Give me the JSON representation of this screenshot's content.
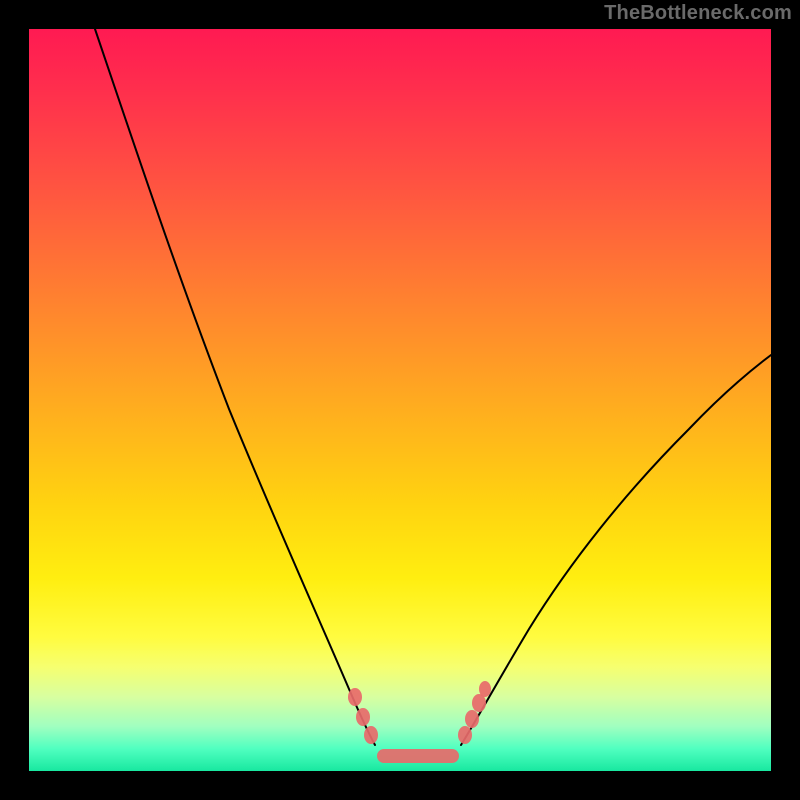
{
  "watermark": "TheBottleneck.com",
  "colors": {
    "frame": "#000000",
    "curve": "#000000",
    "marker": "#e86a6a",
    "gradient_top": "#ff1a52",
    "gradient_bottom": "#18e8a0"
  },
  "chart_data": {
    "type": "line",
    "title": "",
    "xlabel": "",
    "ylabel": "",
    "xlim": [
      0,
      100
    ],
    "ylim": [
      0,
      100
    ],
    "grid": false,
    "legend": false,
    "series": [
      {
        "name": "left-curve",
        "x": [
          9,
          15,
          20,
          25,
          30,
          35,
          40,
          44,
          46
        ],
        "y": [
          100,
          82,
          66,
          51,
          38,
          26,
          16,
          8,
          4
        ]
      },
      {
        "name": "right-curve",
        "x": [
          58,
          62,
          68,
          75,
          82,
          90,
          100
        ],
        "y": [
          4,
          8,
          15,
          23,
          32,
          42,
          55
        ]
      },
      {
        "name": "flat-bottom",
        "x": [
          46,
          58
        ],
        "y": [
          2,
          2
        ]
      }
    ],
    "markers": {
      "left": [
        {
          "x": 44,
          "y": 10
        },
        {
          "x": 45,
          "y": 7
        },
        {
          "x": 46,
          "y": 5
        }
      ],
      "right": [
        {
          "x": 58,
          "y": 5
        },
        {
          "x": 59,
          "y": 7
        },
        {
          "x": 60,
          "y": 9
        },
        {
          "x": 61,
          "y": 11
        }
      ],
      "bottom_bar": {
        "x0": 47,
        "x1": 57,
        "y": 2
      }
    }
  }
}
